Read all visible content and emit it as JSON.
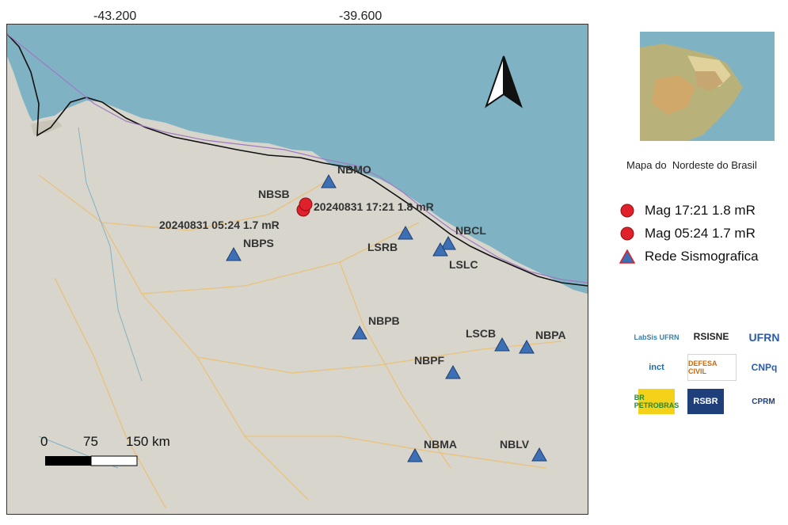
{
  "map": {
    "graticule_top_labels": [
      "-43.200",
      "-39.600"
    ],
    "north_arrow_icon": "north-arrow-icon",
    "colors": {
      "ocean": "#7fb3c4",
      "land": "#d9d6cf",
      "event": "#e0202a",
      "station": "#3d6fb5",
      "coastline": "#111111",
      "state_border": "#a07ac0"
    },
    "events": [
      {
        "label": "20240831 17:21 1.8 mR"
      },
      {
        "label": "20240831 05:24 1.7 mR"
      }
    ],
    "stations": [
      {
        "code": "NBMO"
      },
      {
        "code": "NBSB"
      },
      {
        "code": "NBPS"
      },
      {
        "code": "LSRB"
      },
      {
        "code": "NBCL"
      },
      {
        "code": "LSLC"
      },
      {
        "code": "NBPB"
      },
      {
        "code": "LSCB"
      },
      {
        "code": "NBPA"
      },
      {
        "code": "NBPF"
      },
      {
        "code": "NBMA"
      },
      {
        "code": "NBLV"
      }
    ],
    "scale_bar": {
      "labels": [
        "0",
        "75",
        "150 km"
      ]
    }
  },
  "inset": {
    "caption": "Mapa do  Nordeste do Brasil"
  },
  "legend": {
    "items": [
      {
        "label": "Mag 17:21 1.8 mR",
        "symbol": "circle",
        "color": "#e0202a"
      },
      {
        "label": "Mag 05:24 1.7 mR",
        "symbol": "circle",
        "color": "#e0202a"
      },
      {
        "label": "Rede Sismografica",
        "symbol": "triangle",
        "color": "#3d6fb5"
      }
    ]
  },
  "logos": [
    "LabSis UFRN",
    "RSISNE",
    "UFRN",
    "inct",
    "DEFESA CIVIL",
    "CNPq",
    "BR PETROBRAS",
    "RSBR",
    "CPRM"
  ]
}
